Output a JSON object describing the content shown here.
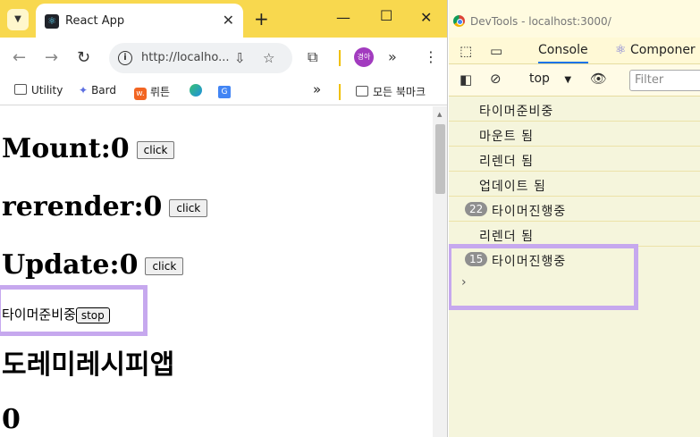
{
  "browser": {
    "tab_title": "React App",
    "url": "http://localho...",
    "profile_label": "경아",
    "bookmarks": [
      "Utility",
      "Bard",
      "뤼튼",
      "모든 북마크"
    ]
  },
  "page": {
    "mount_label": "Mount:0",
    "rerender_label": "rerender:0",
    "update_label": "Update:0",
    "click_label": "click",
    "timer_text": "타이머준비중",
    "stop_label": "stop",
    "scale_text": "도레미레시피앱",
    "counter": "0"
  },
  "devtools": {
    "window_title": "DevTools - localhost:3000/",
    "tabs": [
      "Console",
      "Componer"
    ],
    "context": "top",
    "filter_placeholder": "Filter",
    "logs": [
      {
        "text": "타이머준비중",
        "count": null
      },
      {
        "text": "마운트 됨",
        "count": null
      },
      {
        "text": "리렌더 됨",
        "count": null
      },
      {
        "text": "업데이트 됨",
        "count": null
      },
      {
        "text": "타이머진행중",
        "count": "22"
      },
      {
        "text": "리렌더 됨",
        "count": null
      },
      {
        "text": "타이머진행중",
        "count": "15"
      }
    ],
    "prompt": "›"
  },
  "colors": {
    "titlebar": "#f8d84e",
    "highlight": "#c6a8ee",
    "devtools_bg": "#f5f5dc",
    "profile": "#a23bbf"
  }
}
